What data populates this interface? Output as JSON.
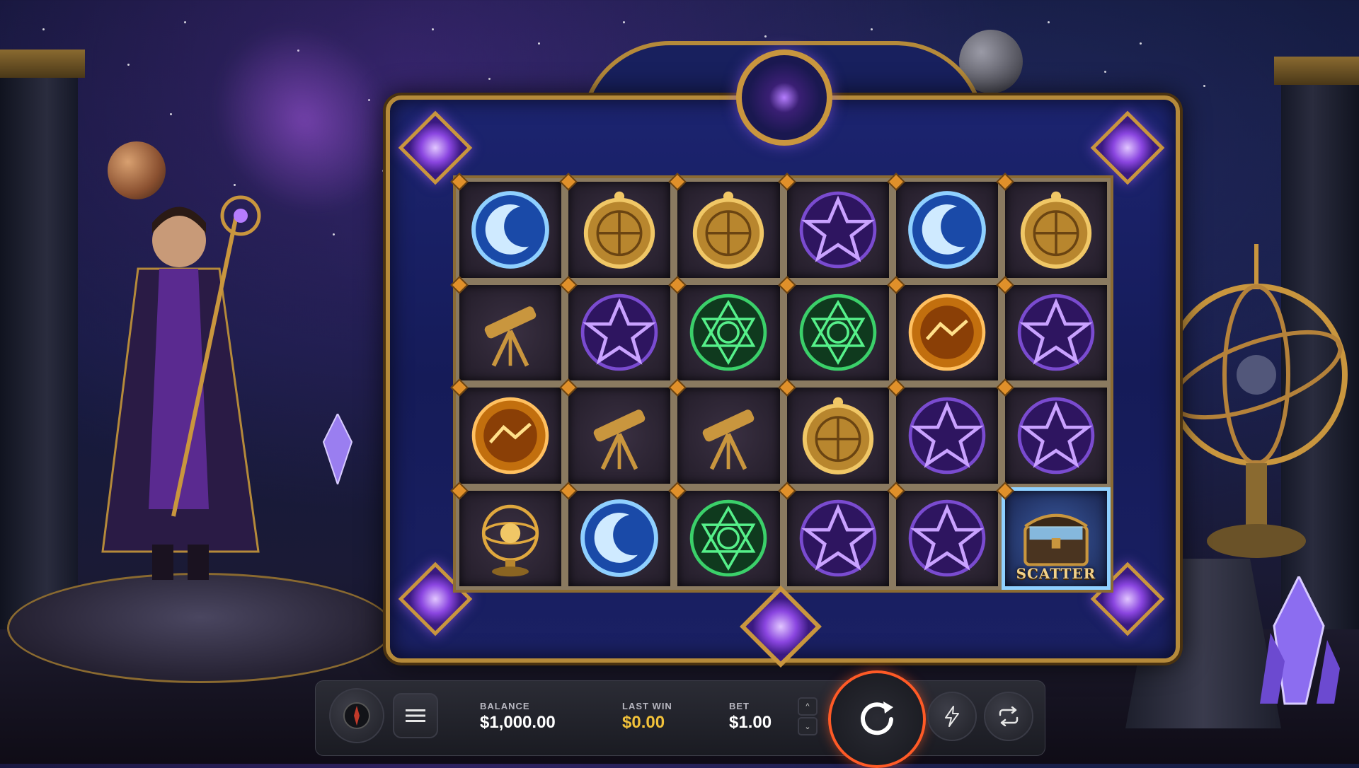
{
  "grid": [
    [
      "moon",
      "compass",
      "compass",
      "pentagram",
      "moon",
      "compass"
    ],
    [
      "telescope",
      "pentagram",
      "hexagram",
      "hexagram",
      "zodiac-orb",
      "pentagram"
    ],
    [
      "zodiac-orb",
      "telescope",
      "telescope",
      "compass",
      "pentagram",
      "pentagram"
    ],
    [
      "armillary",
      "moon",
      "hexagram",
      "pentagram",
      "pentagram",
      "scatter-chest"
    ]
  ],
  "scatter_label": "SCATTER",
  "hud": {
    "balance_label": "BALANCE",
    "balance_value": "$1,000.00",
    "last_win_label": "LAST WIN",
    "last_win_value": "$0.00",
    "bet_label": "BET",
    "bet_value": "$1.00",
    "bet_up_icon": "^",
    "bet_down_icon": "⌄"
  },
  "colors": {
    "accent_spin": "#ff5a26",
    "win_gold": "#f2c23a",
    "frame_gold": "#b58a3a"
  },
  "icons": [
    "sound-icon",
    "menu-icon",
    "spin-icon",
    "turbo-icon",
    "autoplay-icon"
  ]
}
